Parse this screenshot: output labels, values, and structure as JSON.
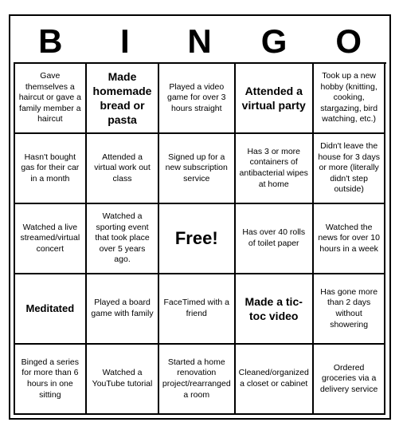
{
  "header": {
    "letters": [
      "B",
      "I",
      "N",
      "G",
      "O"
    ]
  },
  "cells": [
    {
      "id": "r0c0",
      "text": "Gave themselves a haircut or gave a family member a haircut",
      "style": "normal"
    },
    {
      "id": "r0c1",
      "text": "Made homemade bread or pasta",
      "style": "bold-large"
    },
    {
      "id": "r0c2",
      "text": "Played a video game for over 3 hours straight",
      "style": "normal"
    },
    {
      "id": "r0c3",
      "text": "Attended a virtual party",
      "style": "bold-large"
    },
    {
      "id": "r0c4",
      "text": "Took up a new hobby (knitting, cooking, stargazing, bird watching, etc.)",
      "style": "normal"
    },
    {
      "id": "r1c0",
      "text": "Hasn't bought gas for their car in a month",
      "style": "normal"
    },
    {
      "id": "r1c1",
      "text": "Attended a virtual work out class",
      "style": "normal"
    },
    {
      "id": "r1c2",
      "text": "Signed up for a new subscription service",
      "style": "normal"
    },
    {
      "id": "r1c3",
      "text": "Has 3 or more containers of antibacterial wipes at home",
      "style": "normal"
    },
    {
      "id": "r1c4",
      "text": "Didn't leave the house for 3 days or more (literally didn't step outside)",
      "style": "normal"
    },
    {
      "id": "r2c0",
      "text": "Watched a live streamed/virtual concert",
      "style": "normal"
    },
    {
      "id": "r2c1",
      "text": "Watched a sporting event that took place over 5 years ago.",
      "style": "normal"
    },
    {
      "id": "r2c2",
      "text": "Free!",
      "style": "free"
    },
    {
      "id": "r2c3",
      "text": "Has over 40 rolls of toilet paper",
      "style": "normal"
    },
    {
      "id": "r2c4",
      "text": "Watched the news for over 10 hours in a week",
      "style": "normal"
    },
    {
      "id": "r3c0",
      "text": "Meditated",
      "style": "medium-bold"
    },
    {
      "id": "r3c1",
      "text": "Played a board game with family",
      "style": "normal"
    },
    {
      "id": "r3c2",
      "text": "FaceTimed with a friend",
      "style": "normal"
    },
    {
      "id": "r3c3",
      "text": "Made a tic-toc video",
      "style": "bold-large"
    },
    {
      "id": "r3c4",
      "text": "Has gone more than 2 days without showering",
      "style": "normal"
    },
    {
      "id": "r4c0",
      "text": "Binged a series for more than 6 hours in one sitting",
      "style": "normal"
    },
    {
      "id": "r4c1",
      "text": "Watched a YouTube tutorial",
      "style": "normal"
    },
    {
      "id": "r4c2",
      "text": "Started a home renovation project/rearranged a room",
      "style": "normal"
    },
    {
      "id": "r4c3",
      "text": "Cleaned/organized a closet or cabinet",
      "style": "normal"
    },
    {
      "id": "r4c4",
      "text": "Ordered groceries via a delivery service",
      "style": "normal"
    }
  ]
}
